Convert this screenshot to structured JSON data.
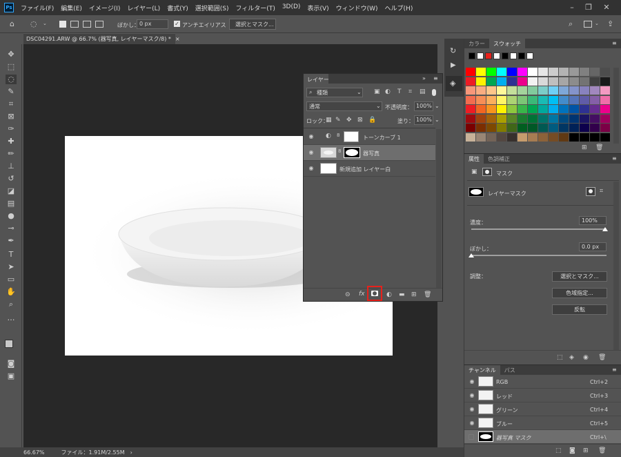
{
  "app": {
    "logo": "Ps"
  },
  "menu": [
    "ファイル(F)",
    "編集(E)",
    "イメージ(I)",
    "レイヤー(L)",
    "書式(Y)",
    "選択範囲(S)",
    "フィルター(T)",
    "3D(D)",
    "表示(V)",
    "ウィンドウ(W)",
    "ヘルプ(H)"
  ],
  "options": {
    "feather_label": "ぼかし：",
    "feather_value": "0 px",
    "antialias_label": "アンチエイリアス",
    "select_mask_button": "選択とマスク..."
  },
  "document": {
    "tab_title": "DSC04291.ARW @ 66.7% (器写真, レイヤーマスク/8) *",
    "zoom": "66.67%",
    "file_info": "ファイル：1.91M/2.55M"
  },
  "layers_panel": {
    "title": "レイヤー",
    "filter_kind": "種類",
    "blend_mode": "通常",
    "opacity_label": "不透明度：",
    "opacity_value": "100%",
    "lock_label": "ロック：",
    "fill_label": "塗り：",
    "fill_value": "100%",
    "layers": [
      {
        "name": "トーンカーブ 1",
        "type": "adjustment"
      },
      {
        "name": "器写真",
        "type": "masked",
        "selected": true
      },
      {
        "name": "新規追加 レイヤー白",
        "type": "fill"
      }
    ]
  },
  "swatch_panel": {
    "tabs": [
      "カラー",
      "スウォッチ"
    ],
    "active_tab": "スウォッチ"
  },
  "properties_panel": {
    "tabs": [
      "属性",
      "色調補正"
    ],
    "section": "マスク",
    "mask_label": "レイヤーマスク",
    "density_label": "濃度：",
    "density_value": "100%",
    "feather_label": "ぼかし：",
    "feather_value": "0.0 px",
    "adjust_label": "調整：",
    "select_mask_button": "選択とマスク...",
    "color_range_button": "色域指定...",
    "invert_button": "反転"
  },
  "channels_panel": {
    "tabs": [
      "チャンネル",
      "パス"
    ],
    "channels": [
      {
        "name": "RGB",
        "shortcut": "Ctrl+2"
      },
      {
        "name": "レッド",
        "shortcut": "Ctrl+3"
      },
      {
        "name": "グリーン",
        "shortcut": "Ctrl+4"
      },
      {
        "name": "ブルー",
        "shortcut": "Ctrl+5"
      },
      {
        "name": "器写真 マスク",
        "shortcut": "Ctrl+\\"
      }
    ]
  },
  "highlight": {
    "color": "#e8211b",
    "target": "add-layer-mask-button"
  }
}
